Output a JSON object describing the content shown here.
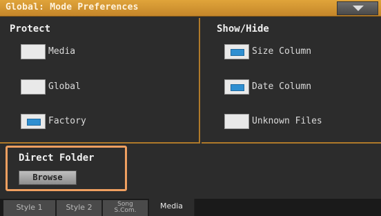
{
  "header": {
    "title": "Global: Mode Preferences",
    "menu_icon": "chevron-down-icon"
  },
  "protect": {
    "title": "Protect",
    "items": [
      {
        "label": "Media",
        "checked": false
      },
      {
        "label": "Global",
        "checked": false
      },
      {
        "label": "Factory",
        "checked": true
      }
    ]
  },
  "show_hide": {
    "title": "Show/Hide",
    "items": [
      {
        "label": "Size Column",
        "checked": true
      },
      {
        "label": "Date Column",
        "checked": true
      },
      {
        "label": "Unknown Files",
        "checked": false
      }
    ]
  },
  "direct_folder": {
    "title": "Direct Folder",
    "browse_label": "Browse"
  },
  "tabs": [
    {
      "label": "Style 1",
      "active": false
    },
    {
      "label": "Style 2",
      "active": false
    },
    {
      "label": "Song\nS.Com.",
      "active": false
    },
    {
      "label": "Media",
      "active": true
    }
  ],
  "colors": {
    "accent": "#f0a060",
    "title_bar": "#d79a35",
    "checkbox_fill": "#2f8fd1"
  }
}
